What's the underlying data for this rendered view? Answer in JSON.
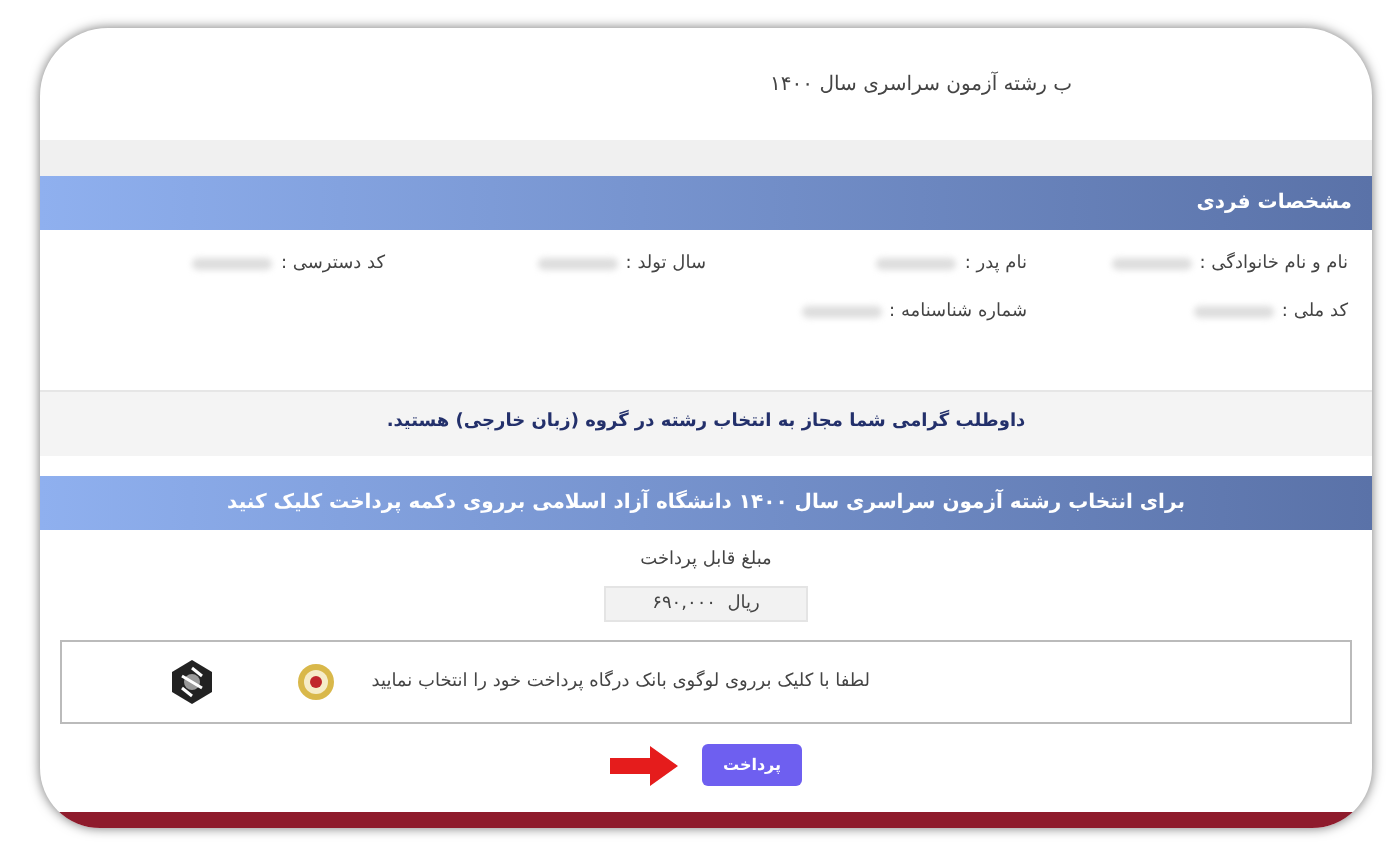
{
  "page_title": "ب رشته آزمون سراسری سال ۱۴۰۰",
  "personal_info": {
    "heading": "مشخصات فردی",
    "rows": [
      [
        {
          "label": "نام و نام خانوادگی :"
        },
        {
          "label": "نام پدر :"
        },
        {
          "label": "سال تولد :"
        },
        {
          "label": "کد دسترسی :"
        }
      ],
      [
        {
          "label": "کد ملی :"
        },
        {
          "label": "شماره شناسنامه :"
        }
      ]
    ]
  },
  "notice": "داوطلب گرامی شما مجاز به انتخاب رشته در گروه (زبان خارجی) هستید.",
  "payment": {
    "heading": "برای انتخاب رشته آزمون سراسری سال ۱۴۰۰ دانشگاه آزاد اسلامی برروی دکمه پرداخت کلیک کنید",
    "amount_label": "مبلغ قابل پرداخت",
    "amount": "۶۹۰,۰۰۰",
    "currency": "ریال",
    "bank_prompt": "لطفا با کلیک برروی لوگوی بانک درگاه پرداخت خود را انتخاب نمایید",
    "pay_button": "پرداخت"
  }
}
